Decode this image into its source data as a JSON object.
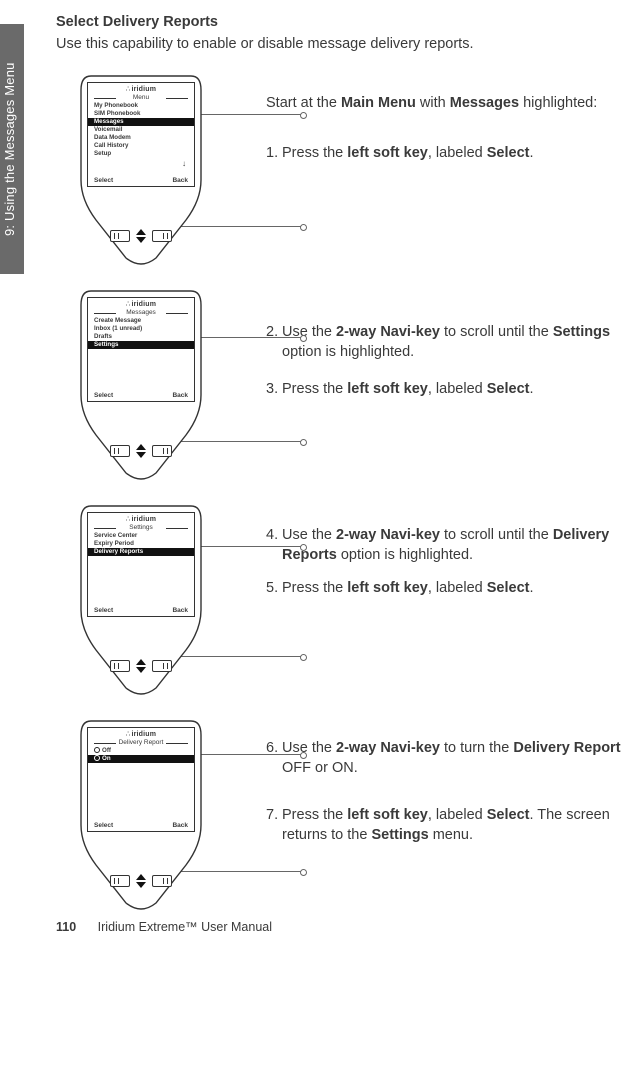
{
  "sideTab": "9: Using the Messages Menu",
  "title": "Select Delivery Reports",
  "intro": "Use this capability to enable or disable message delivery reports.",
  "brand": "iridium",
  "softkeys": {
    "left": "Select",
    "right": "Back"
  },
  "device1": {
    "screenTitle": "Menu",
    "items": [
      "My Phonebook",
      "SIM Phonebook",
      "Messages",
      "Voicemail",
      "Data Modem",
      "Call History",
      "Setup"
    ],
    "highlightIndex": 2,
    "showArrow": true
  },
  "device2": {
    "screenTitle": "Messages",
    "items": [
      "Create Message",
      "Inbox (1 unread)",
      "Drafts",
      "Settings"
    ],
    "highlightIndex": 3
  },
  "device3": {
    "screenTitle": "Settings",
    "items": [
      "Service Center",
      "Expiry Period",
      "Delivery Reports"
    ],
    "highlightIndex": 2
  },
  "device4": {
    "screenTitle": "Delivery Report",
    "options": [
      {
        "label": "Off",
        "selected": false
      },
      {
        "label": "On",
        "selected": true
      }
    ],
    "highlightIndex": 1
  },
  "steps": {
    "intro1_a": "Start at the ",
    "intro1_b": "Main Menu",
    "intro1_c": " with ",
    "intro1_d": "Messages",
    "intro1_e": " highlighted:",
    "s1_a": "Press the ",
    "s1_b": "left soft key",
    "s1_c": ", labeled ",
    "s1_d": "Select",
    "s1_e": ".",
    "s2_a": "Use the ",
    "s2_b": "2-way Navi-key",
    "s2_c": " to scroll until the ",
    "s2_d": "Settings",
    "s2_e": " option is highlighted.",
    "s3_a": "Press the ",
    "s3_b": "left soft key",
    "s3_c": ", labeled ",
    "s3_d": "Select",
    "s3_e": ".",
    "s4_a": "Use the ",
    "s4_b": "2-way Navi-key",
    "s4_c": " to scroll until the ",
    "s4_d": "Delivery Reports",
    "s4_e": " option is highlighted.",
    "s5_a": "Press the ",
    "s5_b": "left soft key",
    "s5_c": ", labeled ",
    "s5_d": "Select",
    "s5_e": ".",
    "s6_a": "Use the ",
    "s6_b": "2-way Navi-key",
    "s6_c": " to turn the ",
    "s6_d": "Delivery Report",
    "s6_e": " OFF or ON.",
    "s7_a": "Press the ",
    "s7_b": "left soft key",
    "s7_c": ", labeled ",
    "s7_d": "Select",
    "s7_e": ". The screen returns to the ",
    "s7_f": "Settings",
    "s7_g": " menu.",
    "n1": "1.",
    "n2": "2.",
    "n3": "3.",
    "n4": "4.",
    "n5": "5.",
    "n6": "6.",
    "n7": "7."
  },
  "footer": {
    "page": "110",
    "manual": "Iridium Extreme™ User Manual"
  }
}
